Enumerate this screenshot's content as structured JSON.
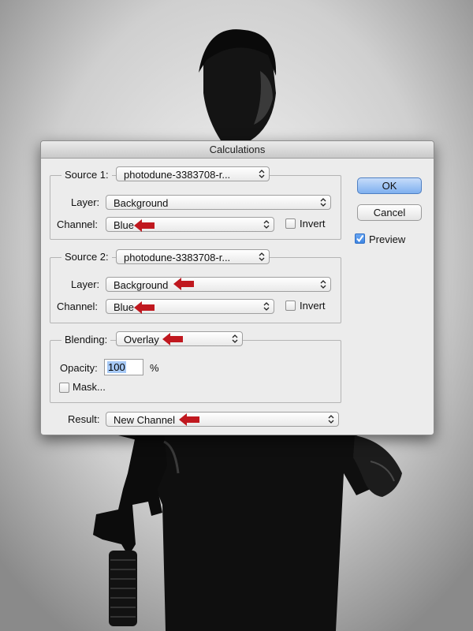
{
  "dialog": {
    "title": "Calculations",
    "source1": {
      "label": "Source 1:",
      "file": "photodune-3383708-r...",
      "layer_label": "Layer:",
      "layer": "Background",
      "channel_label": "Channel:",
      "channel": "Blue",
      "invert_label": "Invert",
      "invert_checked": false
    },
    "source2": {
      "label": "Source 2:",
      "file": "photodune-3383708-r...",
      "layer_label": "Layer:",
      "layer": "Background",
      "channel_label": "Channel:",
      "channel": "Blue",
      "invert_label": "Invert",
      "invert_checked": false
    },
    "blending": {
      "label": "Blending:",
      "mode": "Overlay",
      "opacity_label": "Opacity:",
      "opacity": "100",
      "percent": "%",
      "mask_label": "Mask...",
      "mask_checked": false
    },
    "result": {
      "label": "Result:",
      "value": "New Channel"
    },
    "buttons": {
      "ok": "OK",
      "cancel": "Cancel"
    },
    "preview": {
      "label": "Preview",
      "checked": true
    }
  },
  "colors": {
    "annotation_arrow": "#c0181f",
    "default_button": "#7fb0ef",
    "checkbox_checked": "#3f86e2"
  }
}
